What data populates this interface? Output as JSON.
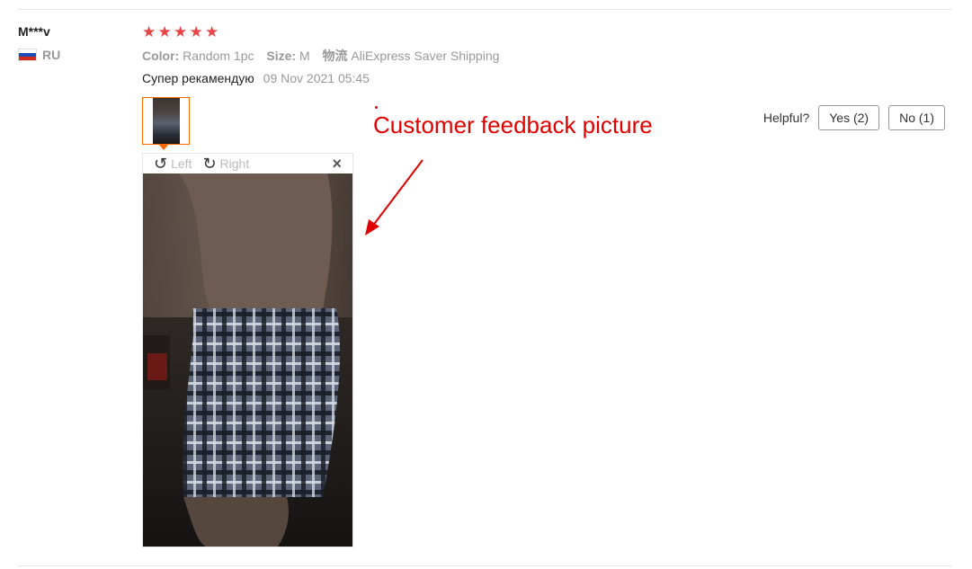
{
  "reviewer": {
    "name": "M***v",
    "country": "RU"
  },
  "rating": {
    "stars": 5,
    "max": 5,
    "color": "#e64545"
  },
  "attributes": [
    {
      "name": "Color:",
      "value": "Random 1pc"
    },
    {
      "name": "Size:",
      "value": "M"
    },
    {
      "name": "物流",
      "value": "AliExpress Saver Shipping"
    }
  ],
  "feedback": {
    "text": "Супер рекамендую",
    "date": "09 Nov 2021 05:45"
  },
  "viewer": {
    "rotate_left": "Left",
    "rotate_right": "Right",
    "close": "×"
  },
  "helpful": {
    "label": "Helpful?",
    "yes": "Yes (2)",
    "no": "No (1)"
  },
  "annotation": {
    "text": "Customer feedback picture",
    "color": "#e00000"
  },
  "accent_color": "#ff6a00"
}
